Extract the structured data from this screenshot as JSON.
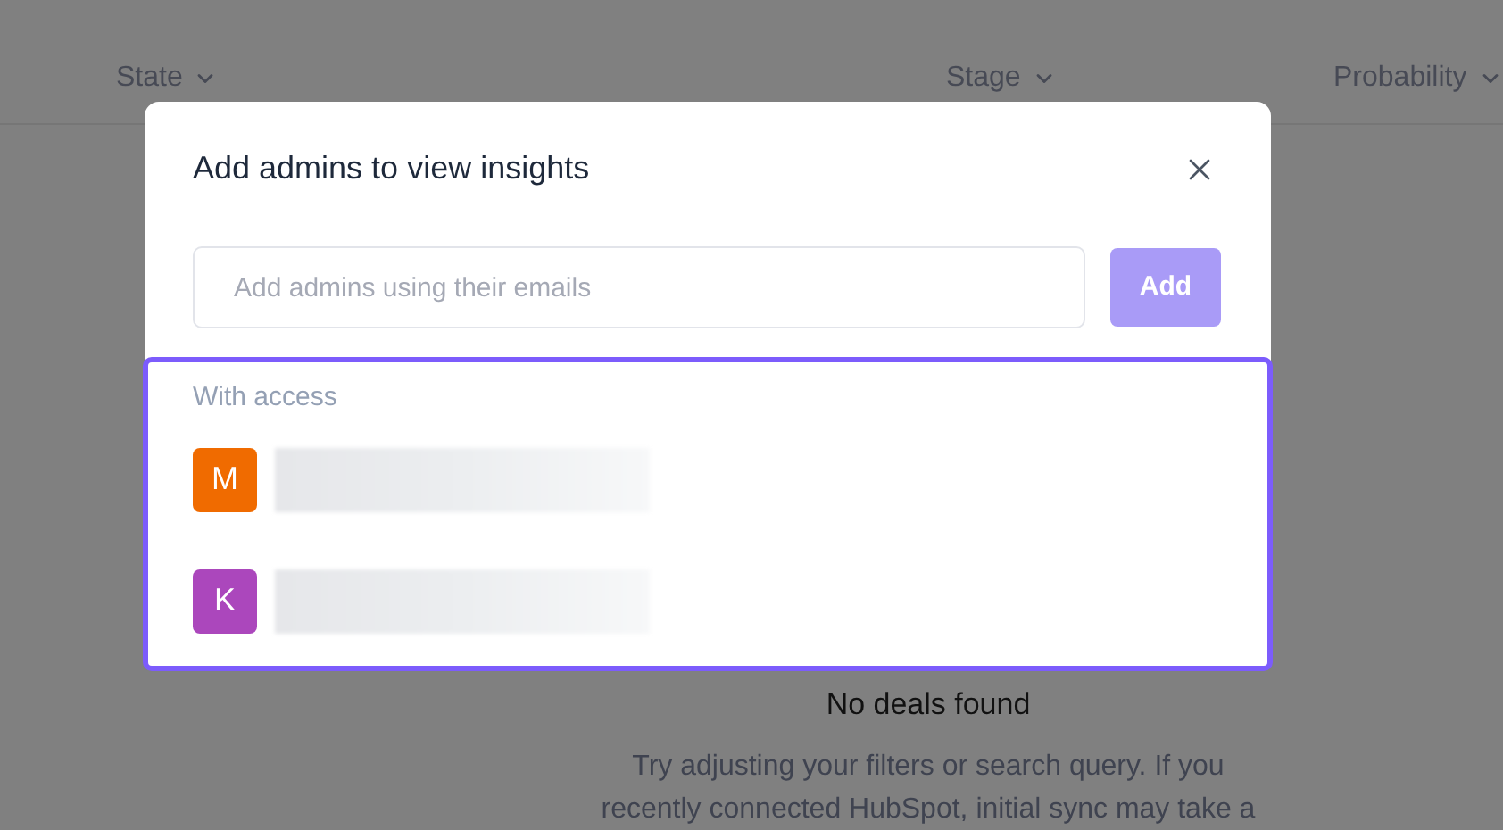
{
  "table": {
    "columns": [
      {
        "label": "State"
      },
      {
        "label": "Stage"
      },
      {
        "label": "Probability"
      }
    ]
  },
  "empty_state": {
    "title": "No deals found",
    "description": "Try adjusting your filters or search query. If you\nrecently connected HubSpot, initial sync may take a"
  },
  "dialog": {
    "title": "Add admins to view insights",
    "email_field": {
      "placeholder": "Add admins using their emails"
    },
    "add_button": {
      "label": "Add",
      "disabled": true
    },
    "access_section": {
      "heading": "With access",
      "highlighted": true,
      "members": [
        {
          "initial": "M",
          "color": "#f06b00"
        },
        {
          "initial": "K",
          "color": "#ab47bc"
        }
      ]
    }
  }
}
